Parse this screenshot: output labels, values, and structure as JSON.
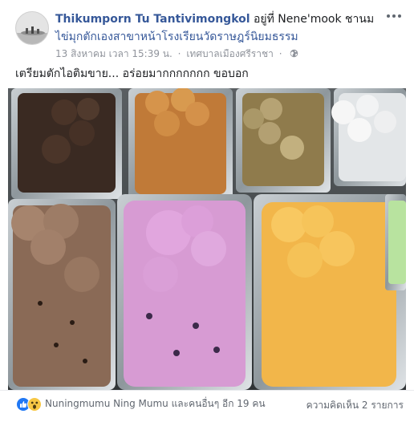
{
  "post": {
    "author": "Thikumporn Tu Tantivimongkol",
    "at_text": "อยู่ที่ Nene'mook ชานม",
    "place_line2": "ไข่มุกตักเองสาขาหน้าโรงเรียนวัดราษฎร์นิยมธรรม",
    "timestamp": "13 สิงหาคม เวลา 15:39 น.",
    "location": "เทศบาลเมืองศรีราชา",
    "separator": "·",
    "caption": "เตรียมตักไอติมขาย... อร่อยมากกกกกกก ขอบอก",
    "icons": {
      "more": "more-options-icon",
      "privacy": "globe-icon",
      "avatar": "profile-avatar"
    }
  },
  "footer": {
    "reactions_text": "Nuningmumu Ning Mumu และคนอื่นๆ อีก 19 คน",
    "reaction_icons": [
      "like-icon",
      "wow-icon"
    ],
    "comments_text": "ความคิดเห็น 2 รายการ"
  },
  "colors": {
    "link": "#365899",
    "meta": "#90949c",
    "like": "#2078f4",
    "wow": "#f7c744"
  }
}
